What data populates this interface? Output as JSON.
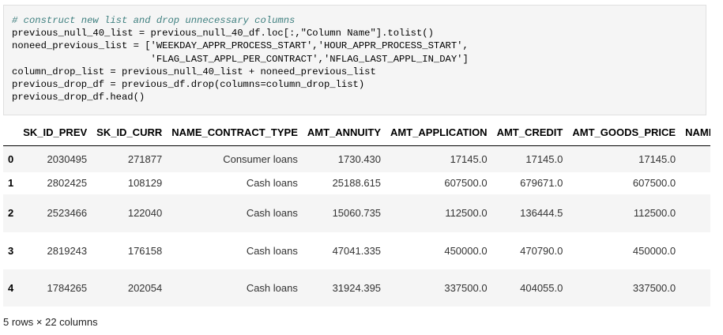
{
  "code": {
    "lines": [
      {
        "comment": "# construct new list and drop unnecessary columns"
      },
      {
        "text": "previous_null_40_list = previous_null_40_df.loc[:,\"Column Name\"].tolist()"
      },
      {
        "text": "noneed_previous_list = ['WEEKDAY_APPR_PROCESS_START','HOUR_APPR_PROCESS_START',"
      },
      {
        "text": "                        'FLAG_LAST_APPL_PER_CONTRACT','NFLAG_LAST_APPL_IN_DAY']"
      },
      {
        "text": "column_drop_list = previous_null_40_list + noneed_previous_list"
      },
      {
        "text": "previous_drop_df = previous_df.drop(columns=column_drop_list)"
      },
      {
        "text": "previous_drop_df.head()"
      }
    ]
  },
  "table": {
    "columns": [
      "SK_ID_PREV",
      "SK_ID_CURR",
      "NAME_CONTRACT_TYPE",
      "AMT_ANNUITY",
      "AMT_APPLICATION",
      "AMT_CREDIT",
      "AMT_GOODS_PRICE",
      "NAME_CAS"
    ],
    "rows": [
      {
        "index": "0",
        "cells": [
          "2030495",
          "271877",
          "Consumer loans",
          "1730.430",
          "17145.0",
          "17145.0",
          "17145.0",
          ""
        ]
      },
      {
        "index": "1",
        "cells": [
          "2802425",
          "108129",
          "Cash loans",
          "25188.615",
          "607500.0",
          "679671.0",
          "607500.0",
          ""
        ]
      },
      {
        "index": "2",
        "cells": [
          "2523466",
          "122040",
          "Cash loans",
          "15060.735",
          "112500.0",
          "136444.5",
          "112500.0",
          ""
        ]
      },
      {
        "index": "3",
        "cells": [
          "2819243",
          "176158",
          "Cash loans",
          "47041.335",
          "450000.0",
          "470790.0",
          "450000.0",
          ""
        ]
      },
      {
        "index": "4",
        "cells": [
          "1784265",
          "202054",
          "Cash loans",
          "31924.395",
          "337500.0",
          "404055.0",
          "337500.0",
          ""
        ]
      }
    ]
  },
  "footer": "5 rows × 22 columns"
}
